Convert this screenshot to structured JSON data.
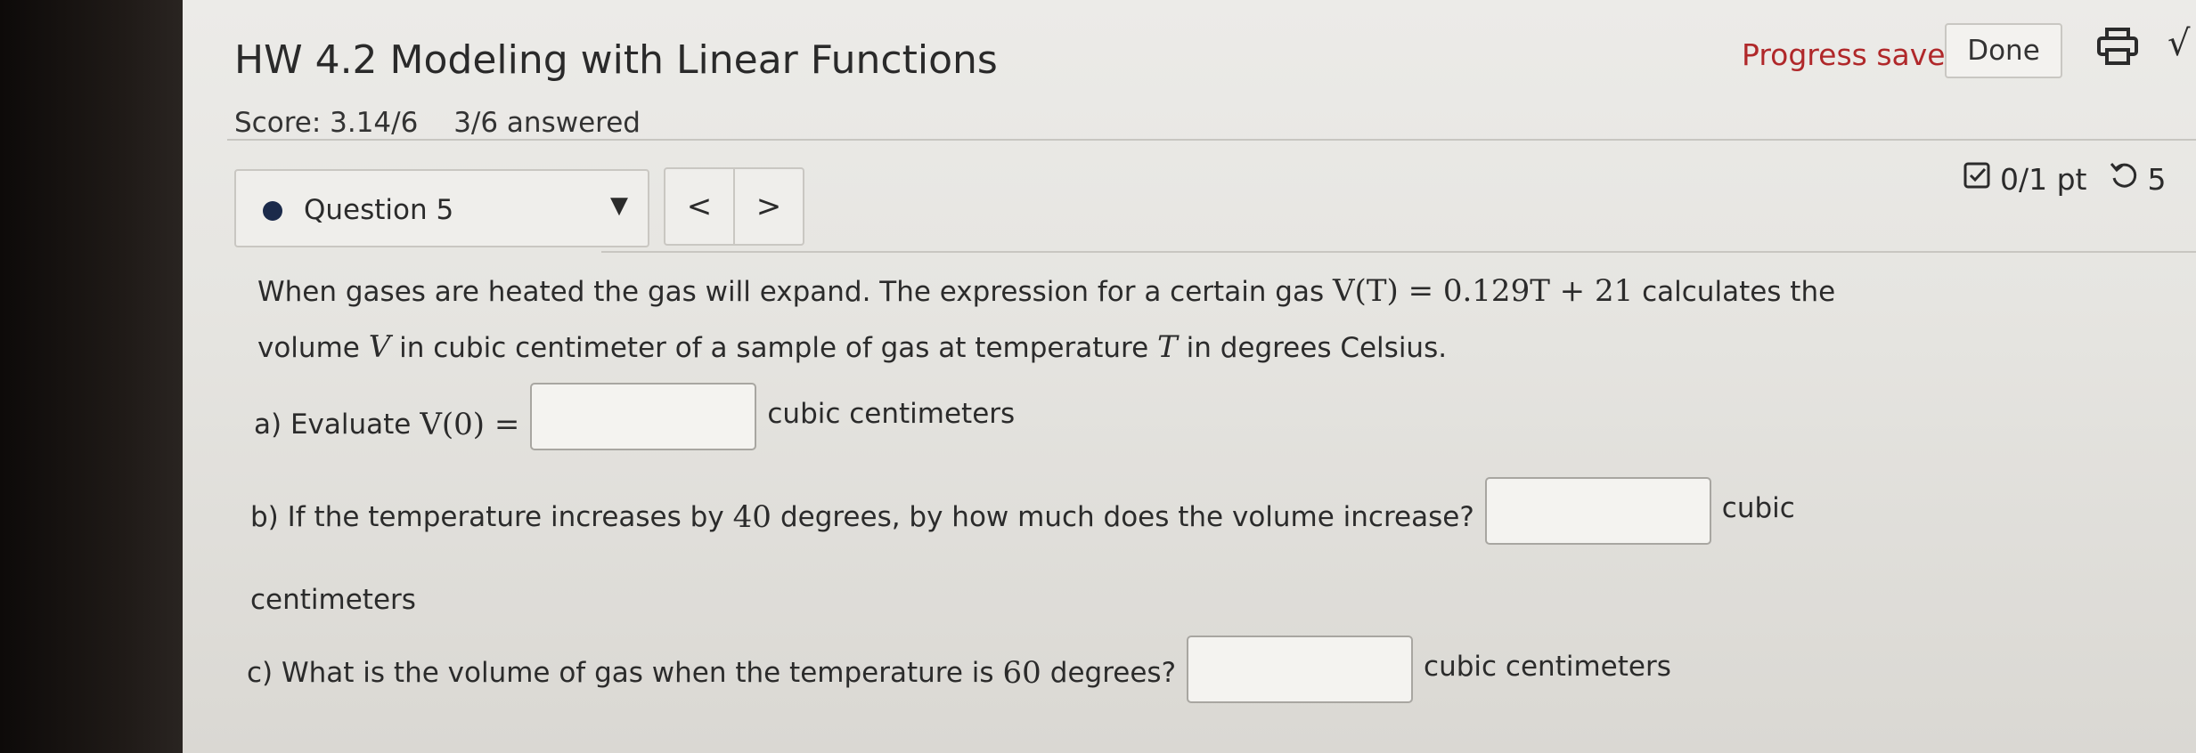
{
  "header": {
    "title": "HW 4.2 Modeling with Linear Functions",
    "score": "Score: 3.14/6",
    "answered": "3/6 answered",
    "progress_status": "Progress saved",
    "done_label": "Done",
    "sqrt_glyph": "√"
  },
  "question_nav": {
    "selected": "Question 5",
    "prev_label": "<",
    "next_label": ">"
  },
  "points": {
    "value": "0/1 pt",
    "retries": "5"
  },
  "question": {
    "intro_1": "When gases are heated the gas will expand. The expression for a certain gas",
    "expression": "V(T) = 0.129T + 21",
    "intro_2": "calculates the volume",
    "var_v": "V",
    "intro_3": "in cubic centimeter of a sample of gas at temperature",
    "var_t": "T",
    "intro_4": "in degrees Celsius.",
    "part_a": {
      "prefix": "a) Evaluate",
      "math": "V(0) =",
      "suffix": "cubic centimeters",
      "value": ""
    },
    "part_b": {
      "prefix": "b) If the temperature increases by",
      "num": "40",
      "mid": "degrees, by how much does the volume increase?",
      "suffix_1": "cubic",
      "suffix_2": "centimeters",
      "value": ""
    },
    "part_c": {
      "prefix": "c) What is the volume of gas when the temperature is",
      "num": "60",
      "mid": "degrees?",
      "suffix": "cubic centimeters",
      "value": ""
    }
  },
  "colors": {
    "progress": "#b0282a",
    "dot": "#1b2a4a"
  }
}
